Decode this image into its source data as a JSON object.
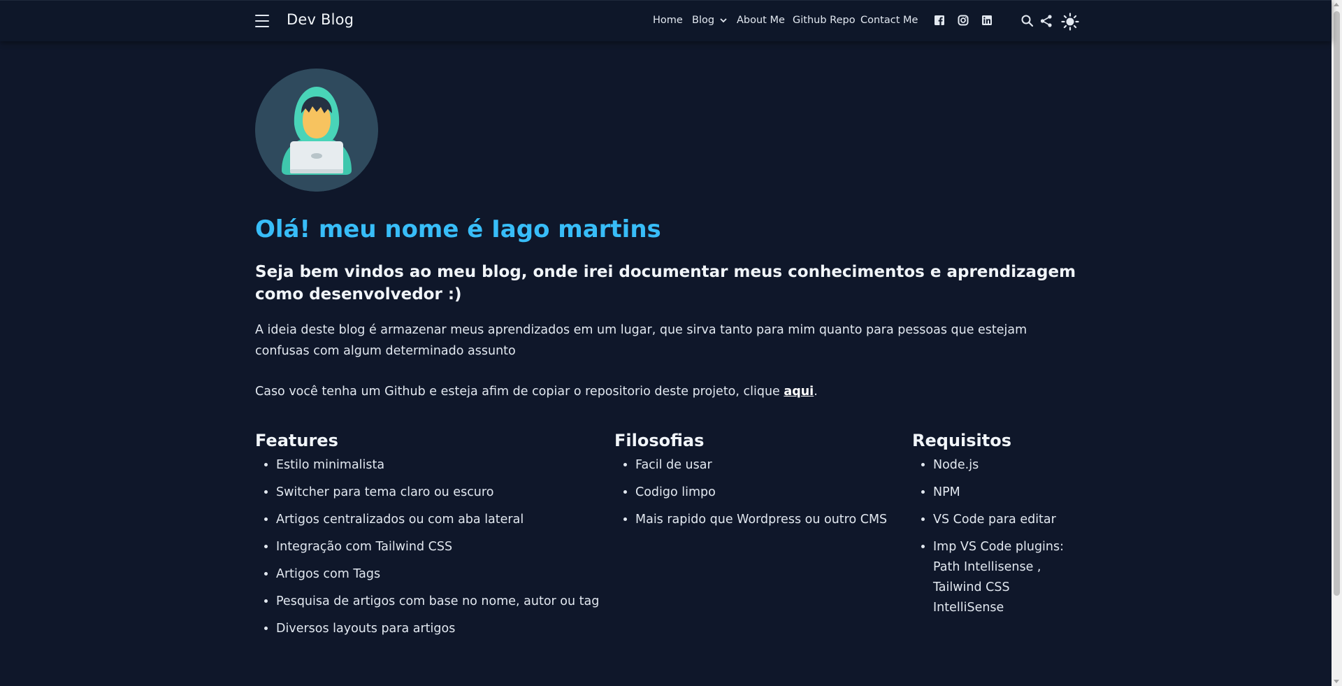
{
  "header": {
    "brand": "Dev Blog",
    "nav": [
      {
        "label": "Home"
      },
      {
        "label": "Blog"
      },
      {
        "label": "About Me"
      },
      {
        "label": "Github Repo"
      },
      {
        "label": "Contact Me"
      }
    ],
    "social_icons": [
      "facebook-icon",
      "instagram-icon",
      "linkedin-icon"
    ],
    "tool_icons": [
      "search-icon",
      "share-icon",
      "sun-icon"
    ]
  },
  "hero": {
    "title": "Olá! meu nome é Iago martins",
    "subtitle": "Seja bem vindos ao meu blog, onde irei documentar meus conhecimentos e aprendizagem como desenvolvedor :)",
    "paragraph1": "A ideia deste blog é armazenar meus aprendizados em um lugar, que sirva tanto para mim quanto para pessoas que estejam confusas com algum determinado assunto",
    "paragraph2_before": "Caso você tenha um Github e esteja afim de copiar o repositorio deste projeto, clique ",
    "paragraph2_link": "aqui",
    "paragraph2_after": "."
  },
  "sections": [
    {
      "title": "Features",
      "items": [
        "Estilo minimalista",
        "Switcher para tema claro ou escuro",
        "Artigos centralizados ou com aba lateral",
        "Integração com Tailwind CSS",
        "Artigos com Tags",
        "Pesquisa de artigos com base no nome, autor ou tag",
        "Diversos layouts para artigos"
      ]
    },
    {
      "title": "Filosofias",
      "items": [
        "Facil de usar",
        "Codigo limpo",
        "Mais rapido que Wordpress ou outro CMS"
      ]
    },
    {
      "title": "Requisitos",
      "items": [
        "Node.js",
        "NPM",
        "VS Code para editar",
        "Imp VS Code plugins: Path Intellisense , Tailwind CSS IntelliSense"
      ]
    }
  ],
  "colors": {
    "background": "#0f172a",
    "accent": "#38bdf8",
    "text": "#e2e8f0"
  }
}
